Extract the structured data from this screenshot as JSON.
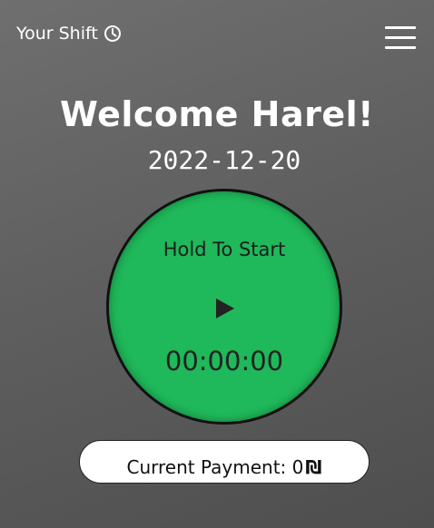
{
  "header": {
    "title": "Your Shift",
    "title_icon": "clock-icon",
    "menu_icon": "hamburger-menu-icon"
  },
  "main": {
    "welcome": "Welcome Harel!",
    "date": "2022-12-20",
    "shift_button": {
      "label": "Hold To Start",
      "icon": "play-icon",
      "timer": "00:00:00",
      "color": "#1fb85a"
    },
    "payment": {
      "label": "Current Payment: 0",
      "currency": "₪"
    }
  }
}
